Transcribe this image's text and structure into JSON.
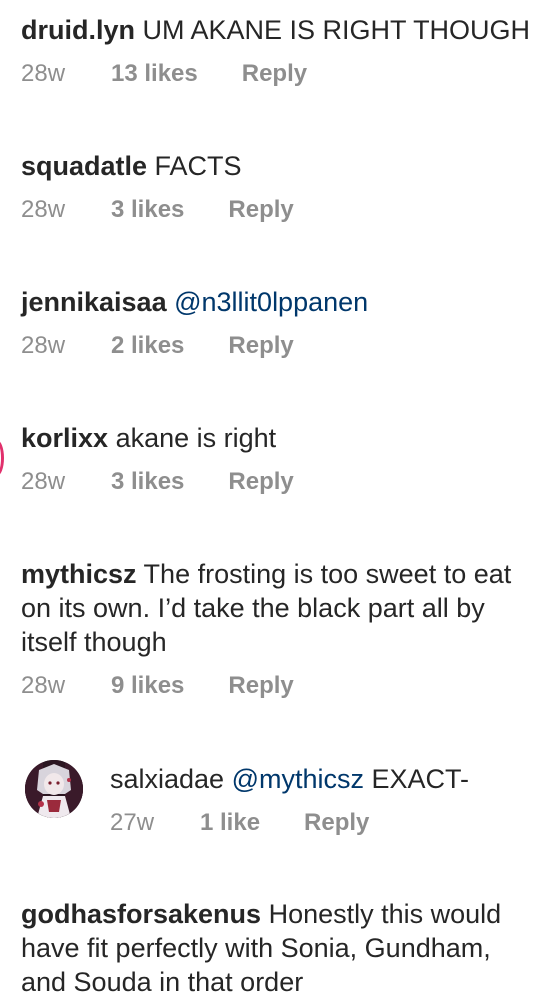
{
  "comments": [
    {
      "username": "druid.lyn",
      "text": " UM AKANE IS RIGHT THOUGH",
      "time": "28w",
      "likes": "13 likes",
      "reply": "Reply"
    },
    {
      "username": "squadatle",
      "text": " FACTS",
      "time": "28w",
      "likes": "3 likes",
      "reply": "Reply"
    },
    {
      "username": "jennikaisaa",
      "mention": "@n3llit0lppanen",
      "text": "",
      "time": "28w",
      "likes": "2 likes",
      "reply": "Reply"
    },
    {
      "username": "korlixx",
      "text": " akane is right",
      "time": "28w",
      "likes": "3 likes",
      "reply": "Reply"
    },
    {
      "username": "mythicsz",
      "text": " The frosting is too sweet to eat on its own. I’d take the black part all by itself though",
      "time": "28w",
      "likes": "9 likes",
      "reply": "Reply"
    },
    {
      "username": "godhasforsakenus",
      "text": " Honestly this would have fit perfectly with Sonia, Gundham, and Souda in that order",
      "time": "",
      "likes": "",
      "reply": ""
    }
  ],
  "reply": {
    "username": "salxiadae",
    "mention": "@mythicsz",
    "text": " EXACT-",
    "time": "27w",
    "likes": "1 like",
    "reply": "Reply",
    "avatar_icon": "anime-avatar-icon"
  },
  "colors": {
    "text": "#262626",
    "meta": "#8e8e8e",
    "mention": "#00376b",
    "story_ring": "#e1306c"
  }
}
